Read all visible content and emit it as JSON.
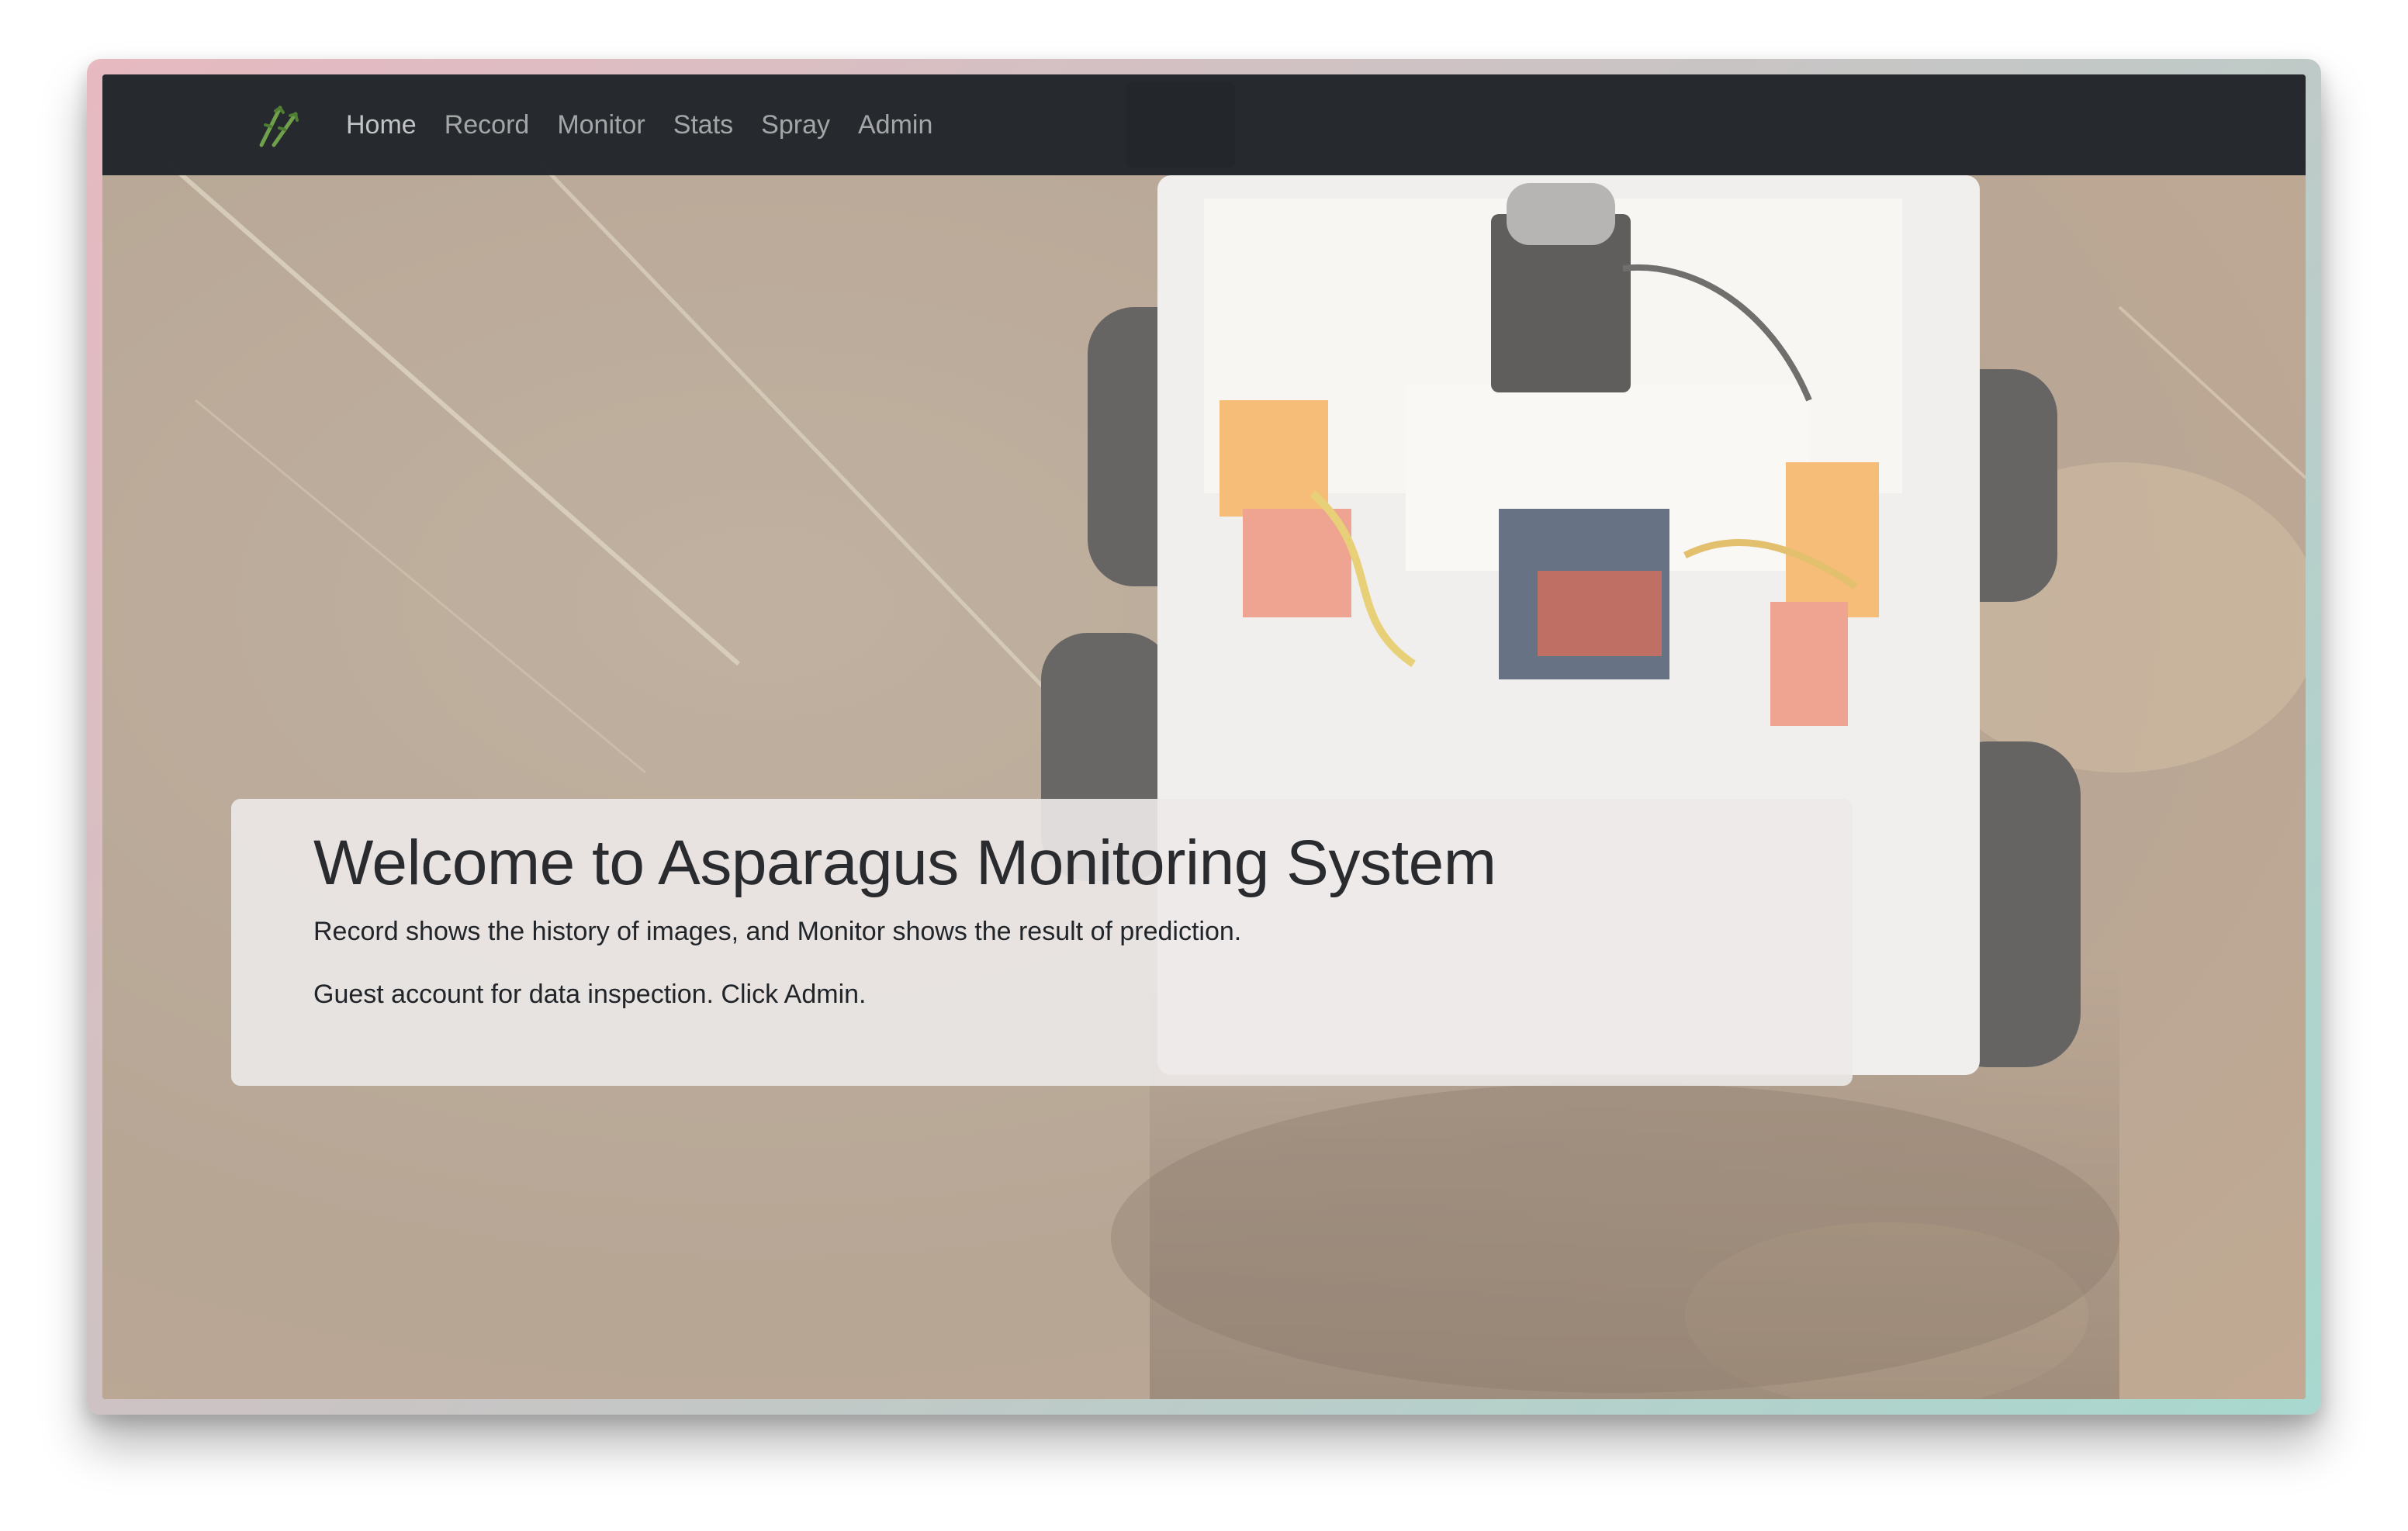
{
  "navbar": {
    "brand_icon": "asparagus-logo-icon",
    "links": [
      {
        "label": "Home"
      },
      {
        "label": "Record"
      },
      {
        "label": "Monitor"
      },
      {
        "label": "Stats"
      },
      {
        "label": "Spray"
      },
      {
        "label": "Admin"
      }
    ]
  },
  "hero": {
    "background": "robot-in-field-photo",
    "title": "Welcome to Asparagus Monitoring System",
    "lead": "Record shows the history of images, and Monitor shows the result of prediction.",
    "guest_note": "Guest account for data inspection. Click Admin."
  },
  "colors": {
    "navbar_bg": "#212529",
    "nav_link": "#9a9da0",
    "card_bg": "#ece9e8",
    "title_text": "#2a2b2e"
  }
}
